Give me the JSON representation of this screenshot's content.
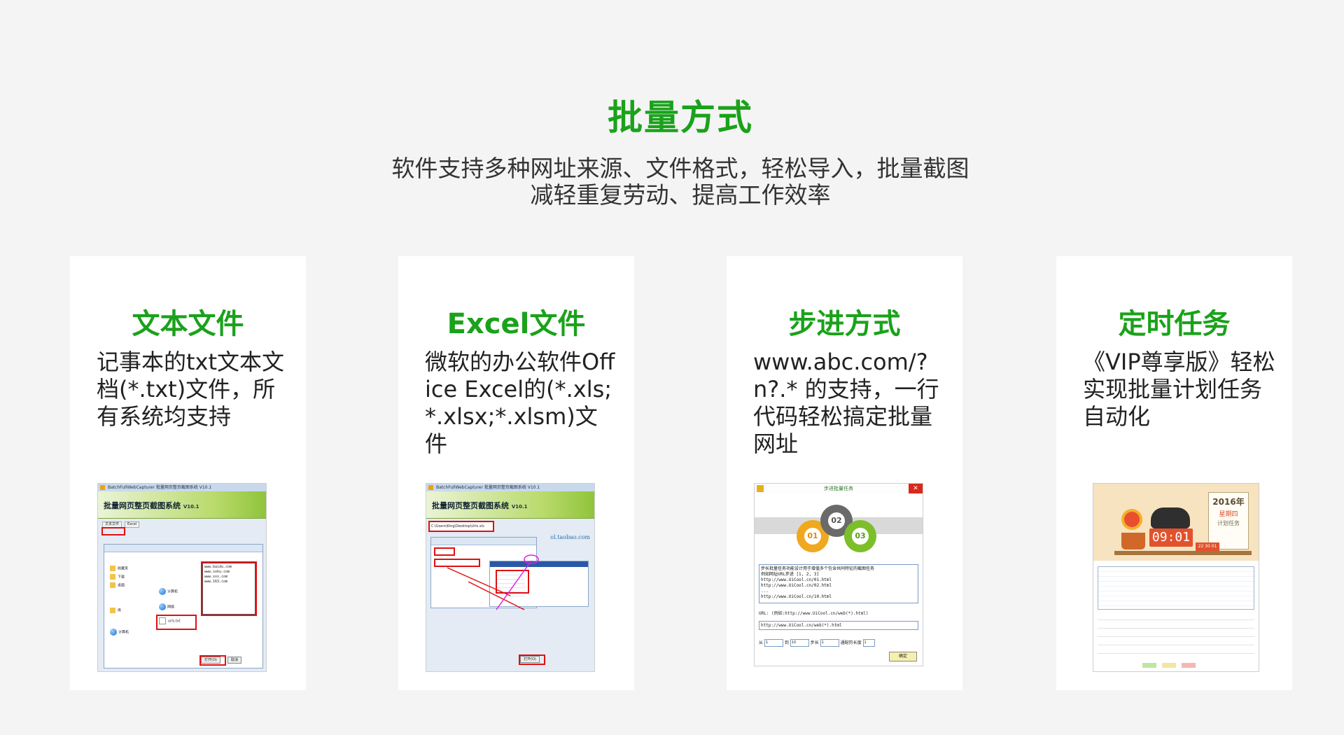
{
  "page": {
    "title": "批量方式",
    "subtitle_line1": "软件支持多种网址来源、文件格式，轻松导入，批量截图",
    "subtitle_line2": "减轻重复劳动、提高工作效率"
  },
  "cards": [
    {
      "title": "文本文件",
      "description": "记事本的txt文本文档(*.txt)文件，所有系统均支持"
    },
    {
      "title": "Excel文件",
      "description": "微软的办公软件Office Excel的(*.xls;*.xlsx;*.xlsm)文件"
    },
    {
      "title": "步进方式",
      "description": "www.abc.com/?n?.* 的支持，一行代码轻松搞定批量网址"
    },
    {
      "title": "定时任务",
      "description": "《VIP尊享版》轻松实现批量计划任务自动化"
    }
  ],
  "screenshot_text": {
    "app_window_title": "BatchFullWebCapturer 批量网页整页截图系统 V10.1",
    "app_name": "批量网页整页截图系统",
    "app_version": "V10.1",
    "app_site": "ol.taobao.com",
    "excel_path": "C:\\Users\\King\\Desktop\\Urls.xls",
    "txt_filename": "urls.txt",
    "txt_urls": [
      "www.baidu.com",
      "www.sohu.com",
      "www.xxx.com",
      "www.163.com"
    ],
    "step_dialog_title": "步进批量任务",
    "step_circles": [
      "01",
      "02",
      "03"
    ],
    "step_memo_lines": [
      "步长批量任务功能设计用于增值多个包含共同特征的截图任务",
      "例如网址URL步进 [1, 2, 3]",
      "http://www.UiCool.cn/01.html",
      "http://www.UiCool.cn/02.html",
      "...",
      "http://www.UiCool.cn/10.html"
    ],
    "step_url_label": "URL: (例如:http://www.UiCool.cn/web(*).html)",
    "step_url_value": "http://www.UiCool.cn/web(*).html",
    "step_from_label": "从",
    "step_from_value": "1",
    "step_to_label": "到",
    "step_to_value": "10",
    "step_step_label": "步长",
    "step_step_value": "1",
    "step_pad_label": "通配符长度",
    "step_pad_value": "1",
    "step_ok_label": "确定",
    "cal_year": "2016年",
    "cal_weekday": "星期四",
    "cal_plan": "计划任务",
    "cal_time": "09:01",
    "cal_date": "22 30 01"
  },
  "colors": {
    "accent_green": "#1aa21a",
    "background": "#f4f4f4",
    "card_background": "#ffffff",
    "highlight_red": "#e01010"
  }
}
